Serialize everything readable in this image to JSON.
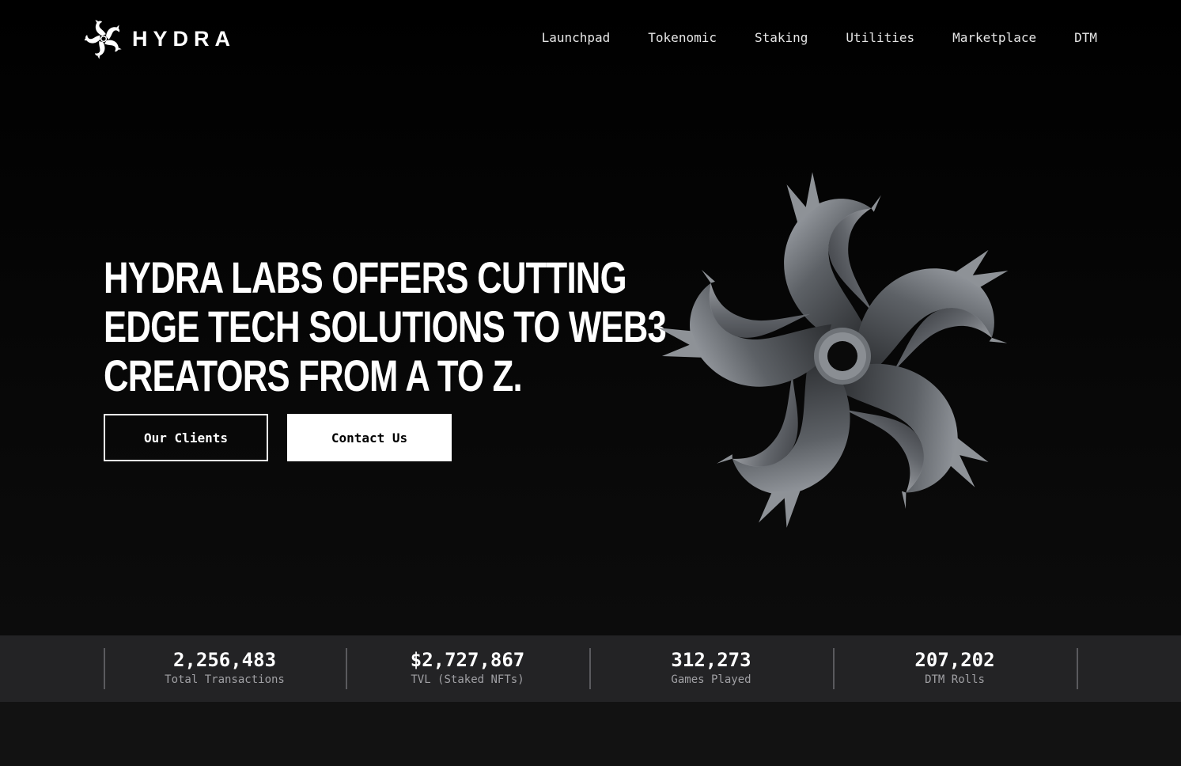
{
  "brand": {
    "name": "HYDRA",
    "logo_icon": "hydra-swirl-icon"
  },
  "nav": {
    "items": [
      {
        "label": "Launchpad"
      },
      {
        "label": "Tokenomic"
      },
      {
        "label": "Staking"
      },
      {
        "label": "Utilities"
      },
      {
        "label": "Marketplace"
      },
      {
        "label": "DTM"
      }
    ]
  },
  "hero": {
    "headline": {
      "bold_brand": "HYDRA LABS",
      "part1": " OFFERS CUTTING",
      "line2": "EDGE TECH SOLUTIONS TO WEB3",
      "part3a": "CREATORS FROM ",
      "bold_a": "A",
      "mid": " TO ",
      "bold_z": "Z",
      "end": "."
    },
    "buttons": {
      "clients": "Our Clients",
      "contact": "Contact Us"
    },
    "emblem_icon": "hydra-emblem-icon"
  },
  "stats": [
    {
      "value": "2,256,483",
      "label": "Total Transactions"
    },
    {
      "value": "$2,727,867",
      "label": "TVL (Staked NFTs)"
    },
    {
      "value": "312,273",
      "label": "Games Played"
    },
    {
      "value": "207,202",
      "label": "DTM Rolls"
    }
  ],
  "colors": {
    "background": "#000000",
    "stats_bar": "#232325",
    "accent": "#ffffff",
    "muted_text": "#a0a0a4"
  }
}
